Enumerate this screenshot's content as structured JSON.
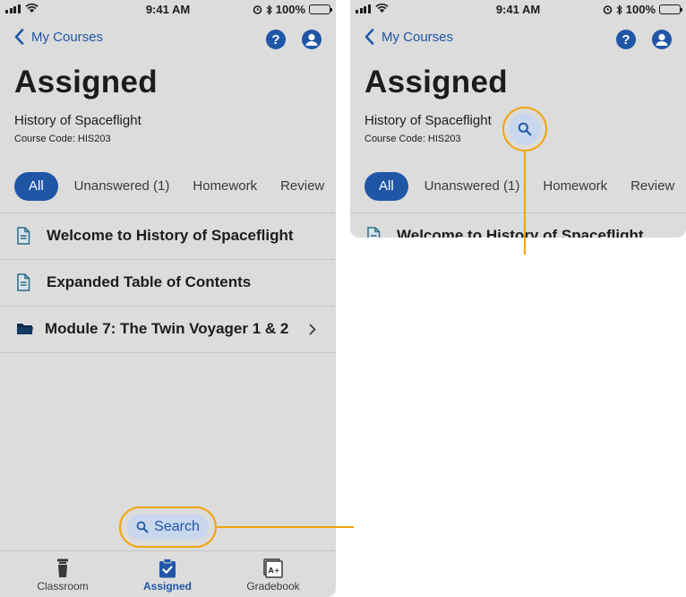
{
  "status": {
    "time": "9:41 AM",
    "battery": "100%"
  },
  "nav": {
    "back_label": "My Courses",
    "help_icon": "question-icon",
    "profile_icon": "user-icon"
  },
  "page": {
    "title": "Assigned",
    "course_name": "History of Spaceflight",
    "course_code": "Course Code: HIS203"
  },
  "tabs": [
    {
      "label": "All",
      "active": true
    },
    {
      "label": "Unanswered (1)",
      "active": false
    },
    {
      "label": "Homework",
      "active": false
    },
    {
      "label": "Review",
      "active": false
    }
  ],
  "items": [
    {
      "label": "Welcome to History of Spaceflight",
      "icon": "document-icon"
    },
    {
      "label": "Expanded Table of Contents",
      "icon": "document-icon"
    },
    {
      "label": "Module 7: The Twin Voyager 1 & 2",
      "icon": "folder-icon"
    }
  ],
  "search": {
    "label": "Search"
  },
  "tabbar": [
    {
      "label": "Classroom",
      "icon": "podium-icon",
      "active": false
    },
    {
      "label": "Assigned",
      "icon": "clipboard-check-icon",
      "active": true
    },
    {
      "label": "Gradebook",
      "icon": "gradebook-icon",
      "active": false
    }
  ],
  "colors": {
    "accent": "#1f56a6",
    "highlight": "#f0a40b",
    "background": "#dcdcdc",
    "pill": "#c9d7ee"
  }
}
